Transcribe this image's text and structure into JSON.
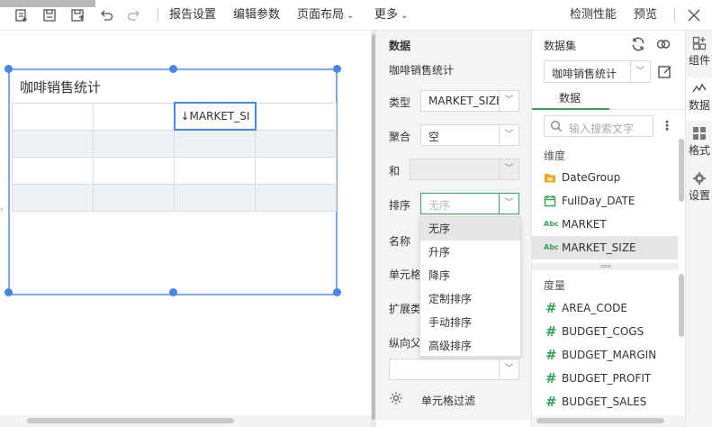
{
  "toolbar": {
    "menus": [
      {
        "label": "报告设置"
      },
      {
        "label": "编辑参数"
      },
      {
        "label": "页面布局"
      },
      {
        "label": "更多"
      }
    ],
    "right": {
      "detect": "检测性能",
      "preview": "预览"
    }
  },
  "report": {
    "title": "咖啡销售统计",
    "cell": "↓MARKET_SI"
  },
  "props": {
    "heading": "数据",
    "dataset_name": "咖啡销售统计",
    "type_label": "类型",
    "type_value": "MARKET_SIZE",
    "agg_label": "聚合",
    "agg_value": "空",
    "and_label": "和",
    "sort_label": "排序",
    "sort_placeholder": "无序",
    "name_label": "名称",
    "cell_label": "单元格",
    "expand_label": "扩展类",
    "vparent_label": "纵向父",
    "cell_filter": "单元格过滤",
    "sort_options": [
      "无序",
      "升序",
      "降序",
      "定制排序",
      "手动排序",
      "高级排序"
    ]
  },
  "dataset": {
    "heading": "数据集",
    "selected": "咖啡销售统计",
    "tab": "数据",
    "search_placeholder": "输入搜索文字",
    "dimension_title": "维度",
    "dimensions": [
      {
        "name": "DateGroup",
        "icon": "folder-icon"
      },
      {
        "name": "FullDay_DATE",
        "icon": "calendar-icon"
      },
      {
        "name": "MARKET",
        "icon": "abc-icon"
      },
      {
        "name": "MARKET_SIZE",
        "icon": "abc-icon"
      }
    ],
    "measure_title": "度量",
    "measures": [
      "AREA_CODE",
      "BUDGET_COGS",
      "BUDGET_MARGIN",
      "BUDGET_PROFIT",
      "BUDGET_SALES"
    ]
  },
  "rstrip": {
    "tabs": [
      {
        "label": "组件"
      },
      {
        "label": "数据"
      },
      {
        "label": "格式"
      },
      {
        "label": "设置"
      }
    ]
  }
}
